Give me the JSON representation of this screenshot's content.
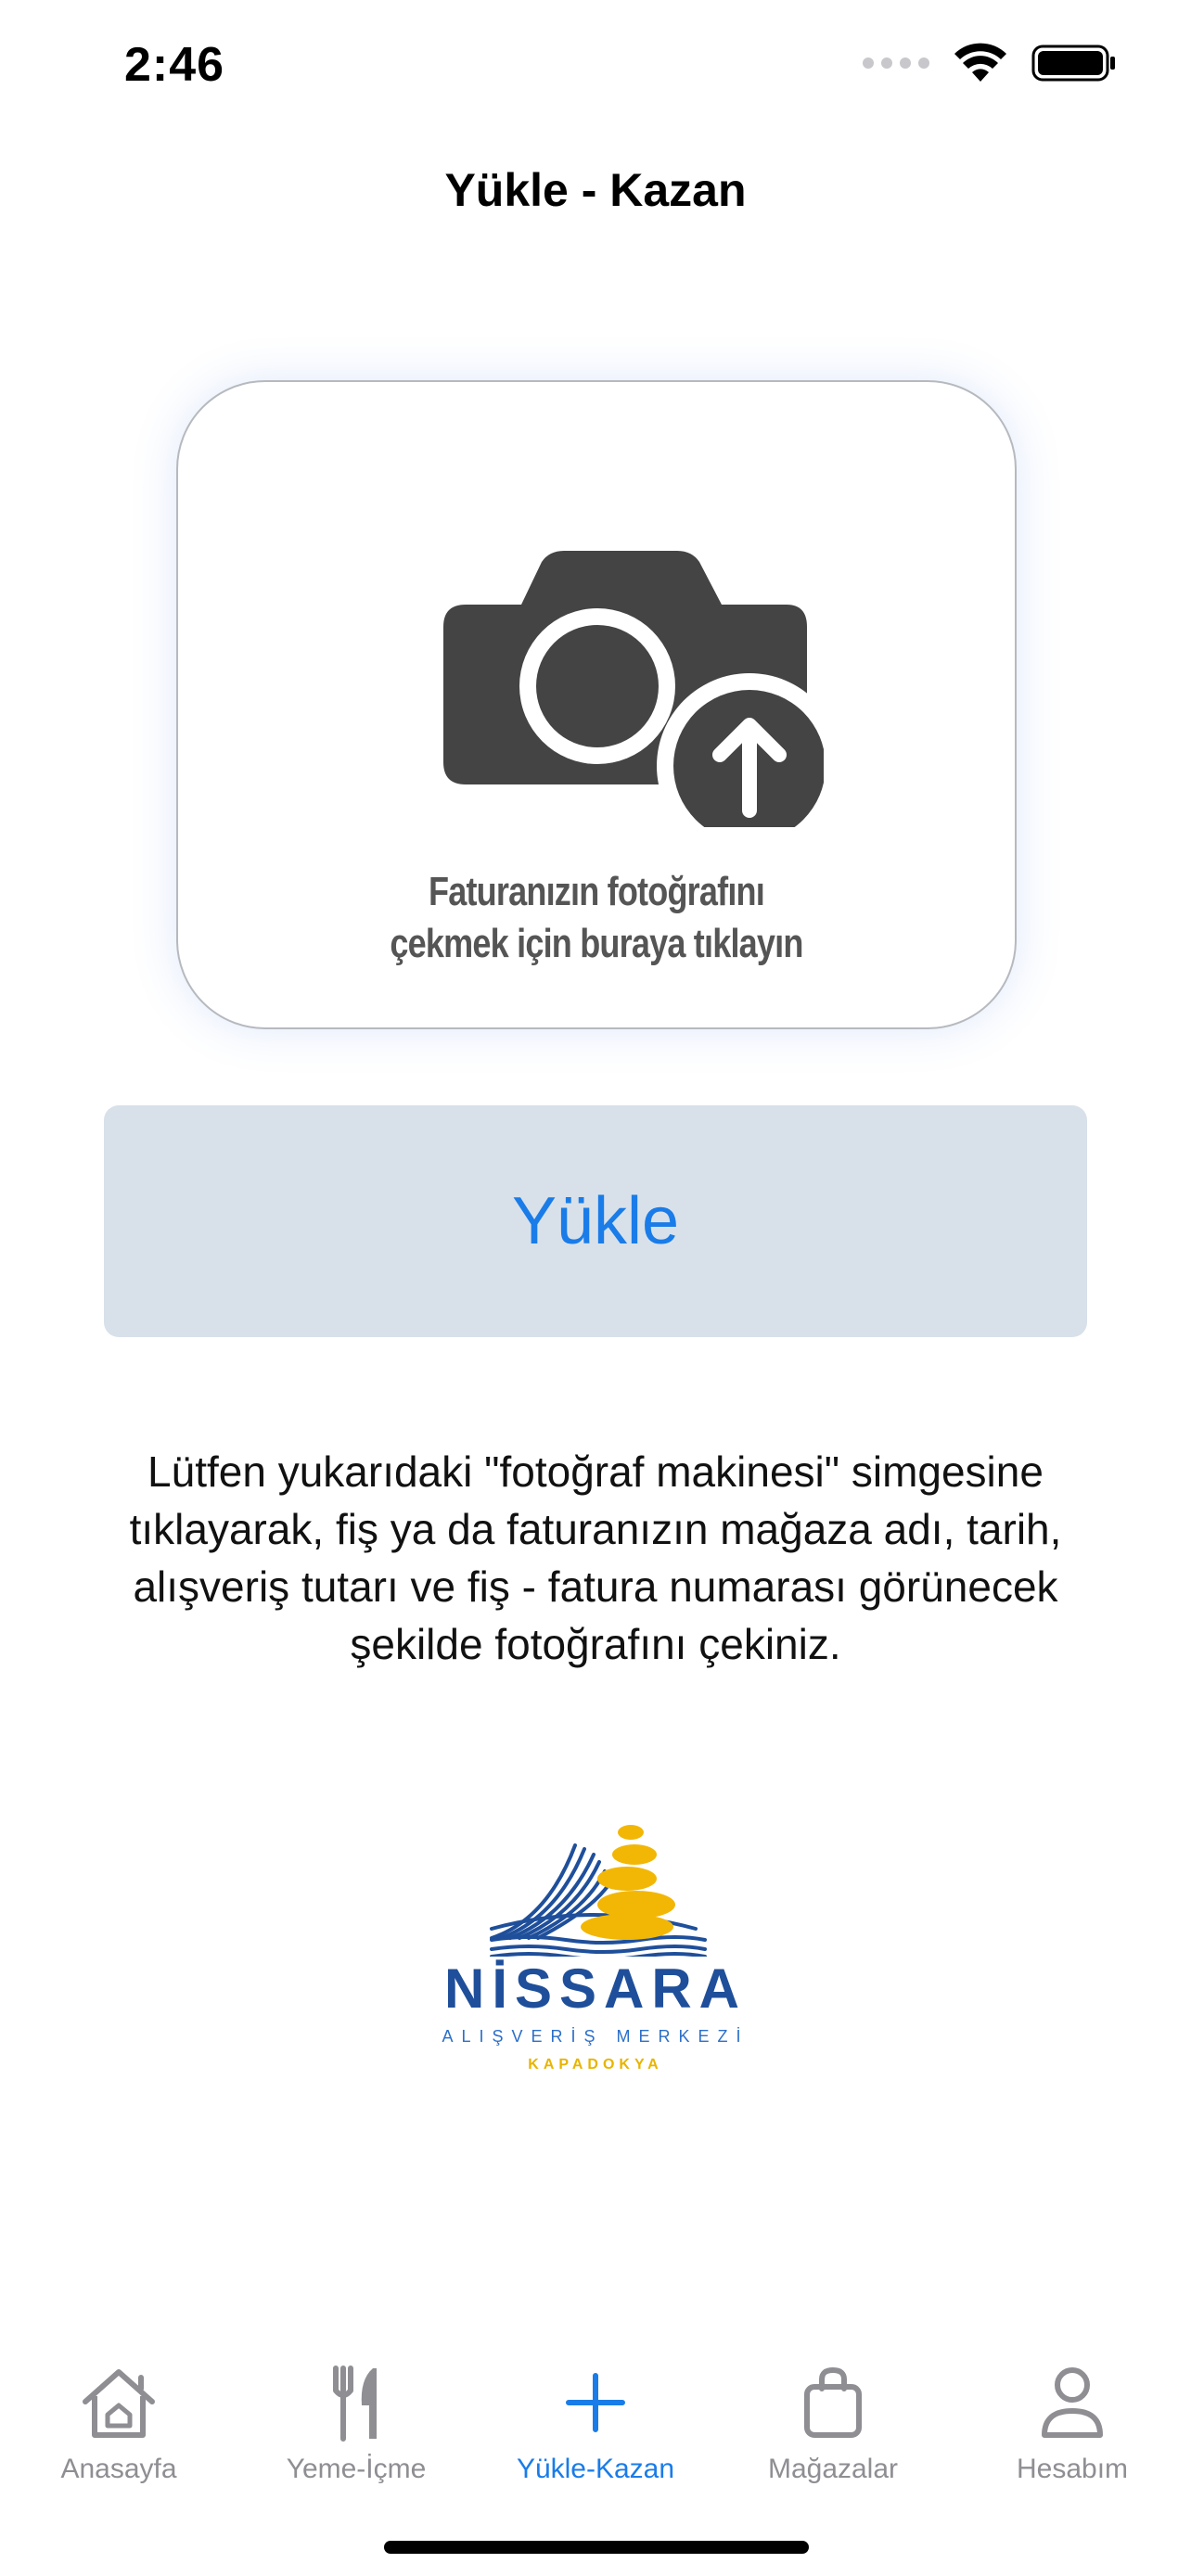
{
  "status_bar": {
    "time": "2:46"
  },
  "nav": {
    "title": "Yükle - Kazan"
  },
  "upload_card": {
    "caption_line1": "Faturanızın fotoğrafını",
    "caption_line2": "çekmek için buraya tıklayın"
  },
  "upload_button": {
    "label": "Yükle"
  },
  "instructions": "Lütfen yukarıdaki \"fotoğraf makinesi\" simgesine tıklayarak, fiş ya da faturanızın mağaza adı, tarih, alışveriş tutarı ve fiş - fatura numarası görünecek şekilde fotoğrafını çekiniz.",
  "logo": {
    "name": "NİSSARA",
    "subtitle": "ALIŞVERİŞ MERKEZİ",
    "region": "KAPADOKYA"
  },
  "tab_bar": {
    "tabs": [
      {
        "label": "Anasayfa",
        "icon": "home-icon",
        "active": false
      },
      {
        "label": "Yeme-İçme",
        "icon": "fork-knife-icon",
        "active": false
      },
      {
        "label": "Yükle-Kazan",
        "icon": "plus-icon",
        "active": true
      },
      {
        "label": "Mağazalar",
        "icon": "shopping-bag-icon",
        "active": false
      },
      {
        "label": "Hesabım",
        "icon": "person-icon",
        "active": false
      }
    ]
  },
  "colors": {
    "accent": "#1a7ce8",
    "button_bg": "#d8e1ea",
    "inactive_tab": "#8e8e93",
    "camera": "#444444",
    "logo_blue": "#1f4f9a",
    "logo_yellow": "#f2b705"
  }
}
